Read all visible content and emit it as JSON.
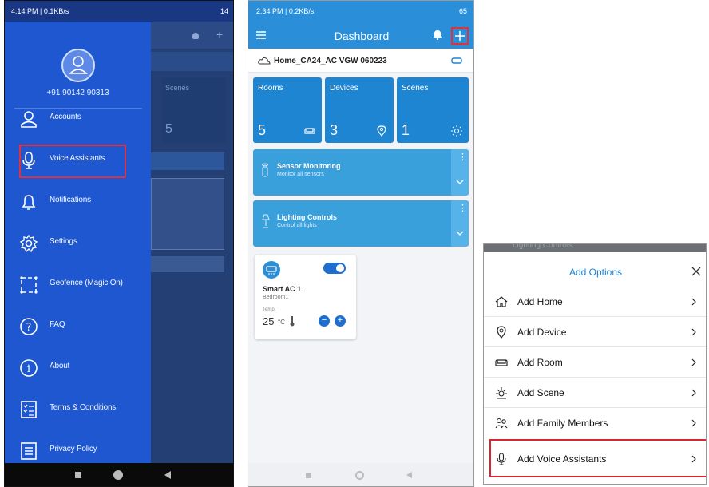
{
  "screen1": {
    "status_left": "4:14 PM | 0.1KB/s",
    "status_right": "14",
    "phone": "+91 90142 90313",
    "overlay_scenes_label": "Scenes",
    "overlay_scenes_count": "5",
    "menu": [
      {
        "label": "Accounts",
        "icon": "person-icon"
      },
      {
        "label": "Voice Assistants",
        "icon": "microphone-icon"
      },
      {
        "label": "Notifications",
        "icon": "bell-icon"
      },
      {
        "label": "Settings",
        "icon": "gear-icon"
      },
      {
        "label": "Geofence (Magic On)",
        "icon": "geofence-icon"
      },
      {
        "label": "FAQ",
        "icon": "question-icon"
      },
      {
        "label": "About",
        "icon": "info-icon"
      },
      {
        "label": "Terms & Conditions",
        "icon": "checklist-icon"
      },
      {
        "label": "Privacy Policy",
        "icon": "document-icon"
      }
    ]
  },
  "screen2": {
    "status_left": "2:34 PM | 0.2KB/s",
    "status_right": "65",
    "title": "Dashboard",
    "home_name": "Home_CA24_AC VGW 060223",
    "tiles": [
      {
        "label": "Rooms",
        "count": "5",
        "icon": "sofa-icon"
      },
      {
        "label": "Devices",
        "count": "3",
        "icon": "location-icon"
      },
      {
        "label": "Scenes",
        "count": "1",
        "icon": "sun-icon"
      }
    ],
    "controls": [
      {
        "title": "Sensor Monitoring",
        "subtitle": "Monitor all sensors"
      },
      {
        "title": "Lighting Controls",
        "subtitle": "Control all lights"
      }
    ],
    "device": {
      "name": "Smart AC 1",
      "room": "Bedroom1",
      "temp_label": "Temp.",
      "temp_value": "25",
      "temp_unit": "°C"
    }
  },
  "screen3": {
    "peek_text": "Lighting Controls",
    "title": "Add Options",
    "options": [
      {
        "label": "Add Home",
        "icon": "home-icon"
      },
      {
        "label": "Add Device",
        "icon": "location-icon"
      },
      {
        "label": "Add Room",
        "icon": "sofa-icon"
      },
      {
        "label": "Add Scene",
        "icon": "sun-icon"
      },
      {
        "label": "Add Family Members",
        "icon": "family-icon"
      },
      {
        "label": "Add Voice Assistants",
        "icon": "microphone-icon"
      }
    ]
  },
  "colors": {
    "drawer": "#1e57cf",
    "accent": "#2a8fd8",
    "highlight": "#e0313e"
  }
}
